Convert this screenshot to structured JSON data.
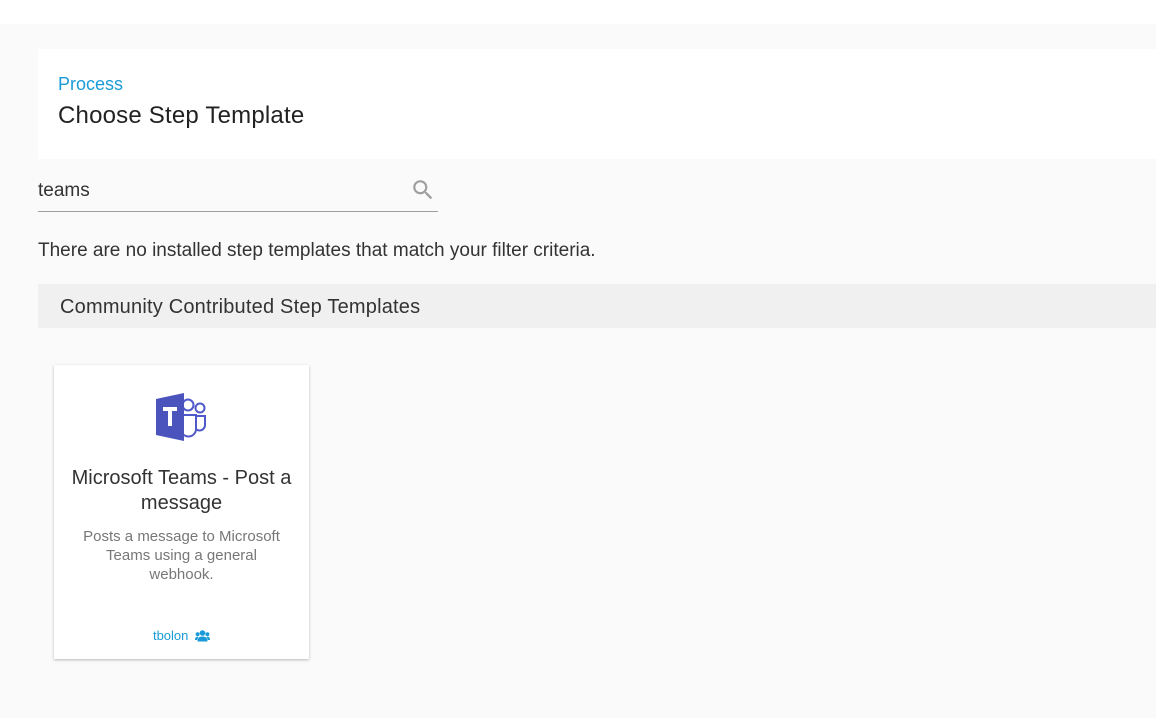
{
  "header": {
    "breadcrumb": "Process",
    "title": "Choose Step Template"
  },
  "search": {
    "value": "teams",
    "icon": "search-icon"
  },
  "installed": {
    "empty_message": "There are no installed step templates that match your filter criteria."
  },
  "community": {
    "section_title": "Community Contributed Step Templates",
    "templates": [
      {
        "logo": "microsoft-teams-logo",
        "title": "Microsoft Teams - Post a message",
        "description": "Posts a message to Microsoft Teams using a general webhook.",
        "author": "tbolon",
        "author_icon": "users-icon"
      }
    ]
  },
  "colors": {
    "accent": "#1a9bd7",
    "teams_purple": "#5059c9",
    "teams_purple_dark": "#4b53bc"
  }
}
